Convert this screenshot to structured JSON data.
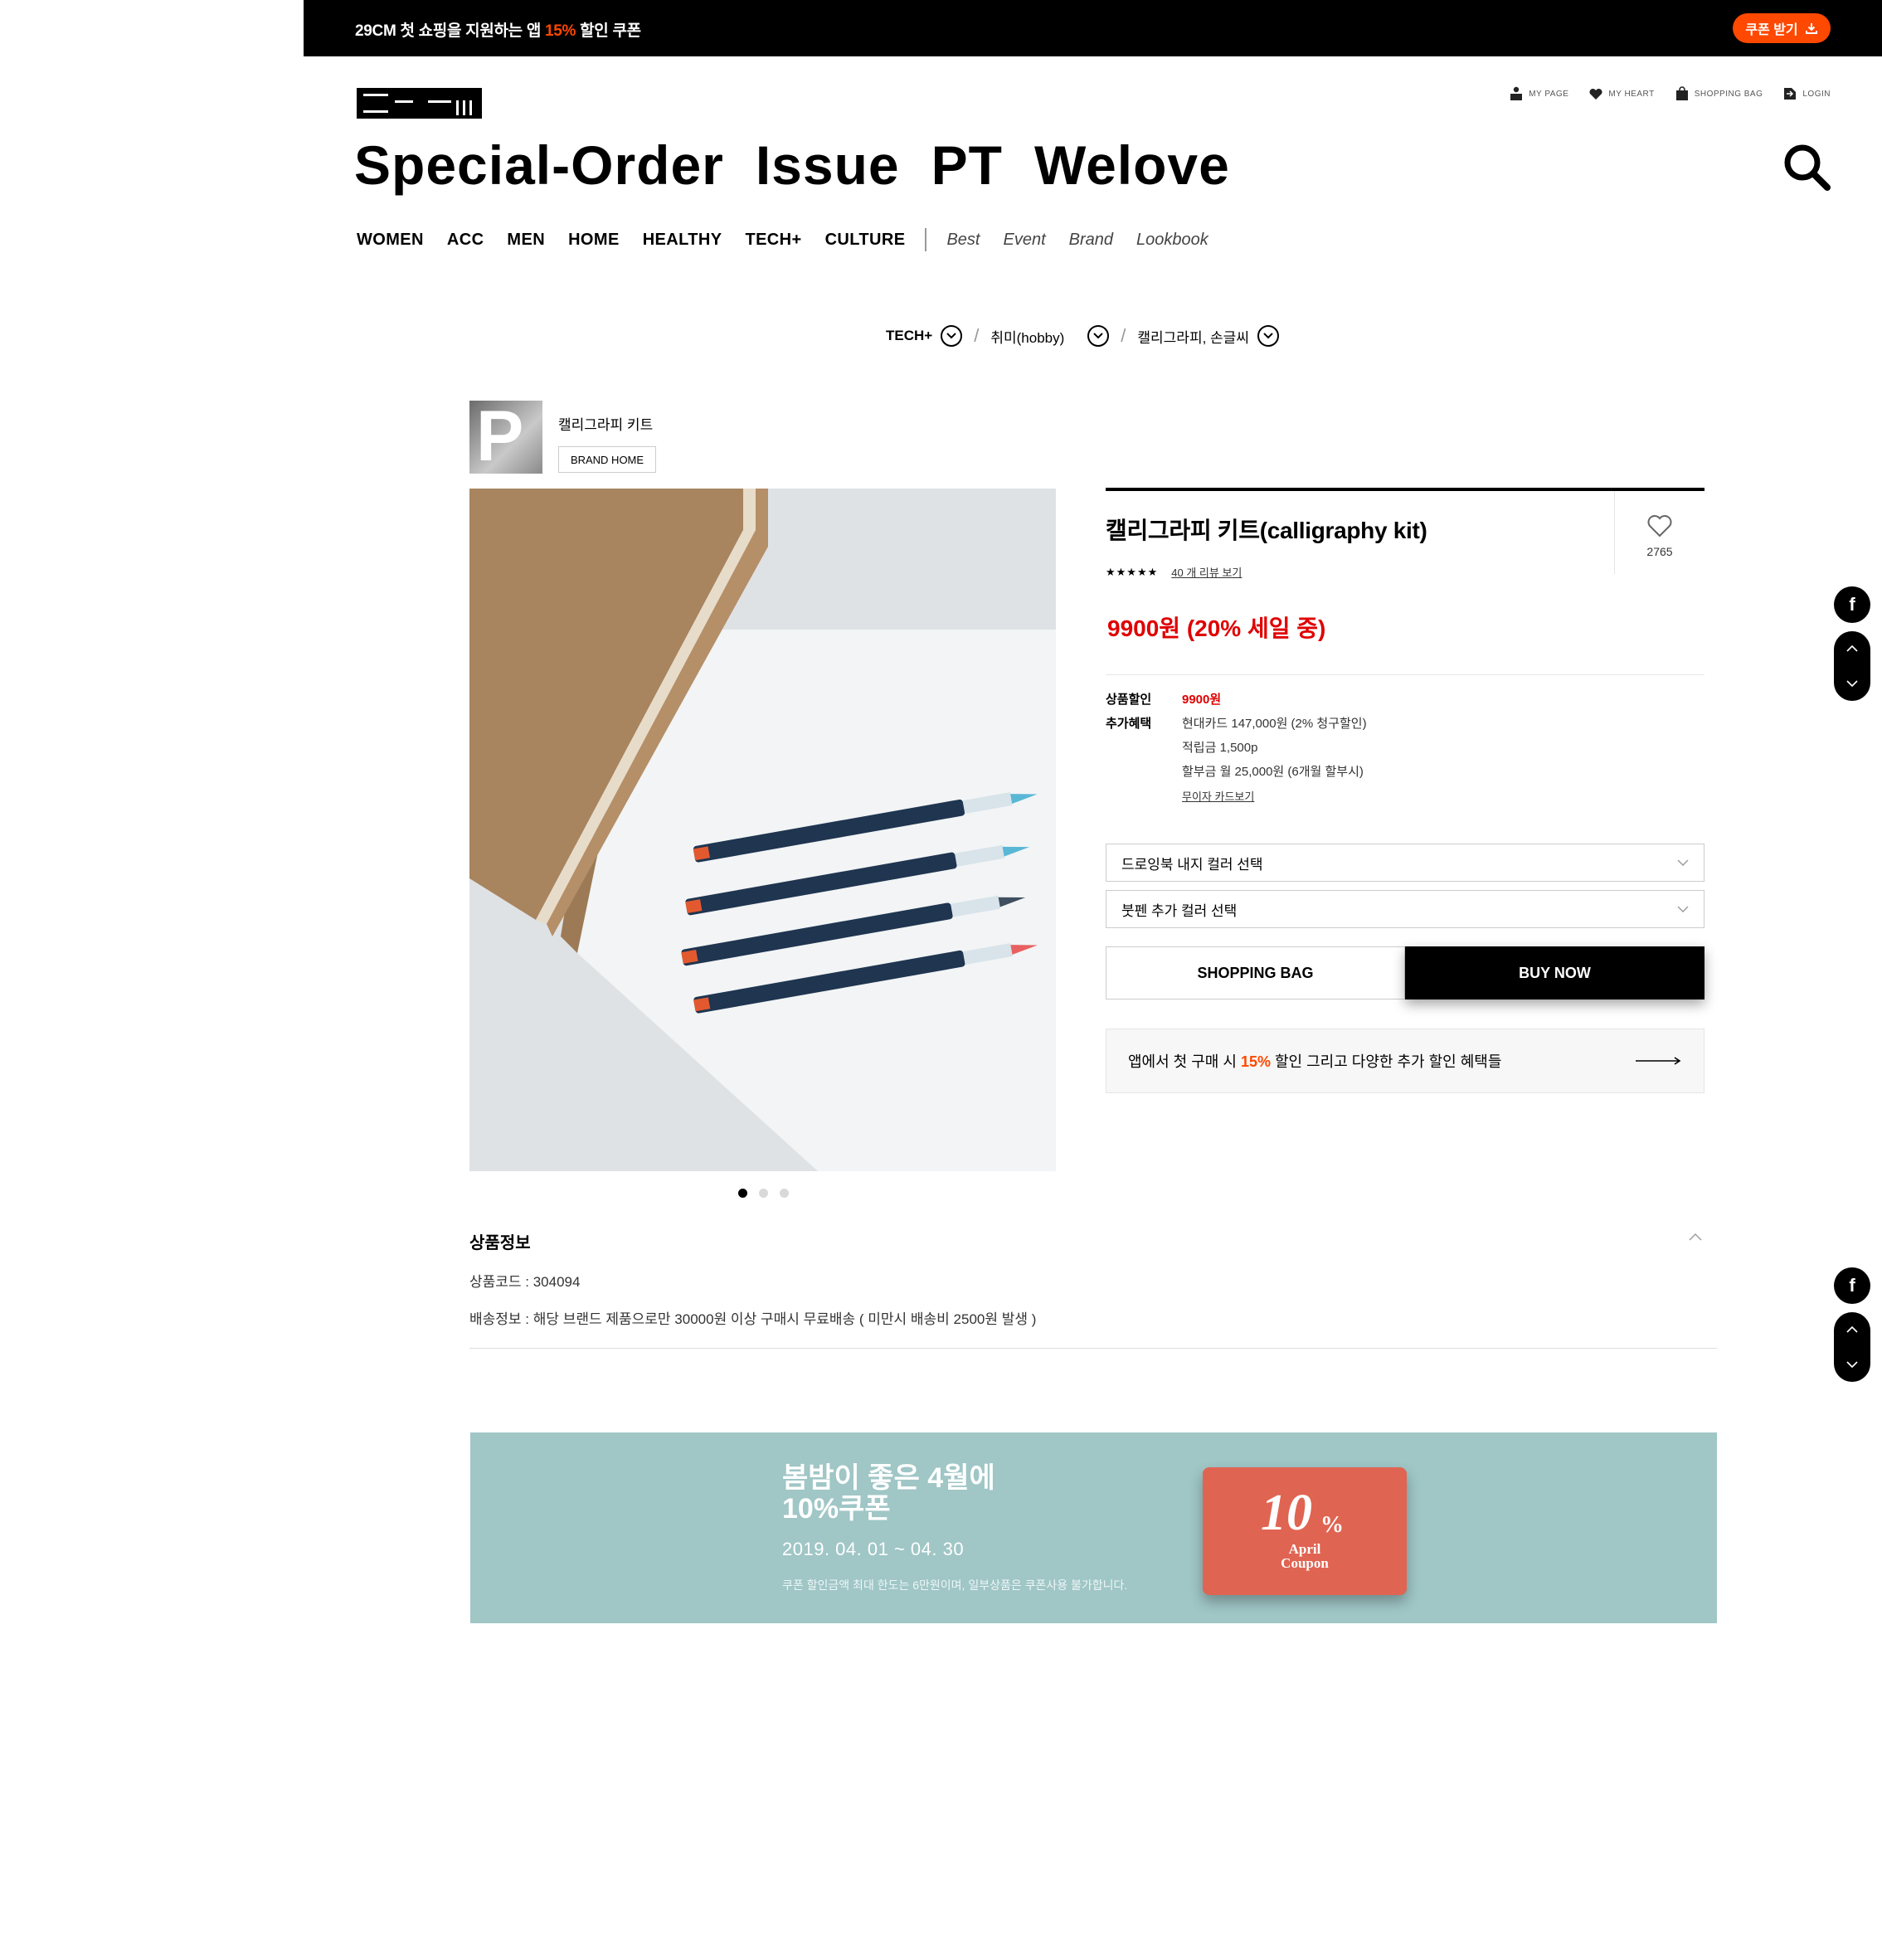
{
  "promo_bar": {
    "text_before": "29CM 첫 쇼핑을 지원하는 앱 ",
    "accent": "15%",
    "text_after": " 할인 쿠폰",
    "coupon_button": "쿠폰 받기",
    "accent_color": "#ff4800"
  },
  "utility_nav": [
    {
      "icon": "person-icon",
      "label": "MY PAGE"
    },
    {
      "icon": "heart-icon",
      "label": "MY HEART"
    },
    {
      "icon": "bag-icon",
      "label": "SHOPPING BAG"
    },
    {
      "icon": "login-icon",
      "label": "LOGIN"
    }
  ],
  "main_nav": [
    "Special-Order",
    "Issue",
    "PT",
    "Welove"
  ],
  "category_nav": [
    "WOMEN",
    "ACC",
    "MEN",
    "HOME",
    "HEALTHY",
    "TECH+",
    "CULTURE"
  ],
  "sub_nav": [
    "Best",
    "Event",
    "Brand",
    "Lookbook"
  ],
  "breadcrumb": [
    "TECH+",
    "취미(hobby)",
    "캘리그라피, 손글씨"
  ],
  "brand": {
    "name": "캘리그라피 키트",
    "home_button": "BRAND HOME"
  },
  "product": {
    "title": "캘리그라피 키트(calligraphy kit)",
    "likes": "2765",
    "stars": "★★★★★",
    "review_link": "40 개 리뷰 보기",
    "price": "9900원 (20% 세일 중)",
    "price_color": "#e00000",
    "discount_label": "상품할인",
    "discount_value": "9900원",
    "benefit_label": "추가혜택",
    "benefit_lines": [
      "현대카드 147,000원 (2% 청구할인)",
      "적립금 1,500p",
      "할부금 월 25,000원 (6개월 할부시)"
    ],
    "card_link": "무이자 카드보기",
    "select_1": "드로잉북 내지 컬러 선택",
    "select_2": "붓펜 추가 컬러 선택",
    "shopping_bag": "SHOPPING BAG",
    "buy_now": "BUY NOW",
    "image_pages": 3,
    "active_image_page": 1
  },
  "app_banner": {
    "before": "앱에서 첫 구매 시 ",
    "accent": "15%",
    "after": " 할인 그리고 다양한 추가 할인 혜택들"
  },
  "product_info": {
    "heading": "상품정보",
    "code": "상품코드 : 304094",
    "shipping": "배송정보 : 해당 브랜드 제품으로만 30000원 이상 구매시 무료배송 ( 미만시 배송비 2500원 발생 )"
  },
  "coupon_banner": {
    "line1": "봄밤이 좋은 4월에",
    "line2": "10%쿠폰",
    "dates": "2019. 04. 01 ~ 04. 30",
    "note": "쿠폰 할인금액 최대 한도는 6만원이며, 일부상품은 쿠폰사용 불가합니다.",
    "card_number": "10",
    "card_percent": "%",
    "card_month": "April",
    "card_word": "Coupon",
    "background_color": "#a0c6c6",
    "card_color": "#e06452"
  },
  "float_buttons": {
    "share": "f"
  }
}
